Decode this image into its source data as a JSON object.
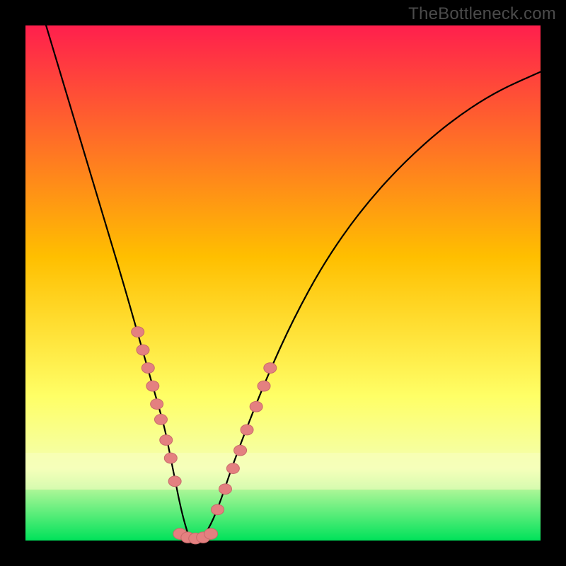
{
  "watermark": "TheBottleneck.com",
  "colors": {
    "frame": "#000000",
    "gradient_top": "#ff1f4d",
    "gradient_mid": "#ffbf00",
    "gradient_low": "#ffff66",
    "gradient_band": "#f3ffb0",
    "gradient_bottom": "#00e25a",
    "curve": "#000000",
    "marker_fill": "#e48080",
    "marker_stroke": "#c86a6a"
  },
  "chart_data": {
    "type": "line",
    "title": "",
    "xlabel": "",
    "ylabel": "",
    "xlim": [
      0,
      100
    ],
    "ylim": [
      0,
      100
    ],
    "curve": {
      "x": [
        4,
        7,
        10,
        13,
        16,
        19,
        21,
        23,
        25,
        27,
        28,
        29,
        30,
        31,
        32,
        33,
        34,
        36,
        38,
        40,
        43,
        47,
        52,
        58,
        65,
        73,
        82,
        91,
        100
      ],
      "y": [
        100,
        90,
        80,
        70,
        60,
        50,
        43,
        36,
        29,
        22,
        17,
        12,
        7,
        3,
        0,
        0,
        0,
        3,
        8,
        14,
        22,
        32,
        43,
        54,
        64,
        73,
        81,
        87,
        91
      ]
    },
    "markers_left": {
      "x": [
        21.8,
        22.8,
        23.8,
        24.7,
        25.5,
        26.3,
        27.3,
        28.2,
        29.0
      ],
      "y": [
        40.5,
        37.0,
        33.5,
        30.0,
        26.5,
        23.5,
        19.5,
        16.0,
        11.5
      ]
    },
    "markers_right": {
      "x": [
        37.3,
        38.8,
        40.3,
        41.7,
        43.0,
        44.8,
        46.3,
        47.5
      ],
      "y": [
        6.0,
        10.0,
        14.0,
        17.5,
        21.5,
        26.0,
        30.0,
        33.5
      ]
    },
    "markers_bottom": {
      "x": [
        30.0,
        31.5,
        33.0,
        34.5,
        36.0
      ],
      "y": [
        1.3,
        0.6,
        0.4,
        0.6,
        1.3
      ]
    }
  }
}
